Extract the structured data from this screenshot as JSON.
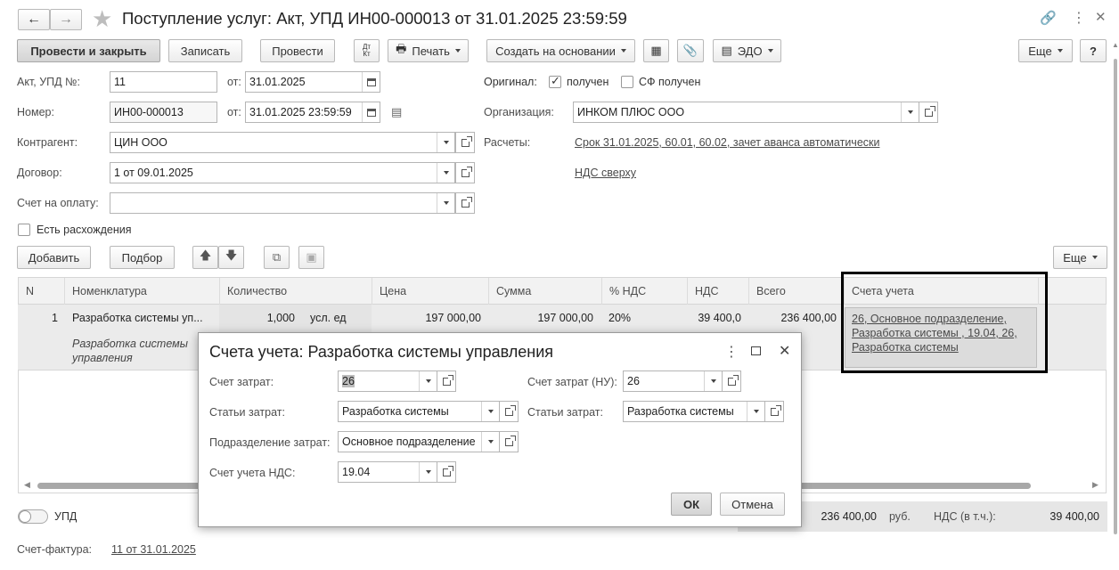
{
  "window": {
    "title": "Поступление услуг: Акт, УПД ИН00-000013 от 31.01.2025 23:59:59"
  },
  "toolbar": {
    "post_close": "Провести и закрыть",
    "save": "Записать",
    "post": "Провести",
    "dt_kt_top": "Дт",
    "dt_kt_bottom": "Кт",
    "print": "Печать",
    "create_based": "Создать на основании",
    "edo": "ЭДО",
    "more": "Еще",
    "help": "?"
  },
  "form": {
    "act_label": "Акт, УПД №:",
    "act_value": "11",
    "from_label": "от:",
    "act_date": "31.01.2025",
    "number_label": "Номер:",
    "number_value": "ИН00-000013",
    "number_date": "31.01.2025 23:59:59",
    "counterparty_label": "Контрагент:",
    "counterparty_value": "ЦИН ООО",
    "contract_label": "Договор:",
    "contract_value": "1 от 09.01.2025",
    "invoice_label": "Счет на оплату:",
    "invoice_value": "",
    "discrepancy_label": "Есть расхождения",
    "original_label": "Оригинал:",
    "received_label": "получен",
    "sf_received_label": "СФ получен",
    "org_label": "Организация:",
    "org_value": "ИНКОМ ПЛЮС ООО",
    "settlements_label": "Расчеты:",
    "settlements_link": "Срок 31.01.2025, 60.01, 60.02, зачет аванса автоматически",
    "vat_link": "НДС сверху"
  },
  "table_toolbar": {
    "add": "Добавить",
    "select": "Подбор",
    "more": "Еще"
  },
  "table": {
    "headers": [
      "N",
      "Номенклатура",
      "Количество",
      "Цена",
      "Сумма",
      "% НДС",
      "НДС",
      "Всего",
      "Счета учета"
    ],
    "row": {
      "n": "1",
      "nomenclature": "Разработка системы уп...",
      "nomenclature_desc_1": "Разработка системы",
      "nomenclature_desc_2": "управления",
      "qty": "1,000",
      "unit": "усл. ед",
      "price": "197 000,00",
      "sum": "197 000,00",
      "vat_rate": "20%",
      "vat": "39 400,0",
      "total": "236 400,00",
      "accounts_1": "26, Основное подразделение,",
      "accounts_2": "Разработка системы , 19.04, 26,",
      "accounts_3": "Разработка системы"
    }
  },
  "footer": {
    "upd_label": "УПД",
    "total": "236 400,00",
    "currency": "руб.",
    "vat_incl_label": "НДС (в т.ч.):",
    "vat_incl_value": "39 400,00",
    "sf_label": "Счет-фактура:",
    "sf_link": "11 от 31.01.2025"
  },
  "dialog": {
    "title": "Счета учета: Разработка системы управления",
    "cost_account_label": "Счет затрат:",
    "cost_account_value": "26",
    "cost_account_nu_label": "Счет затрат (НУ):",
    "cost_account_nu_value": "26",
    "cost_items_label": "Статьи затрат:",
    "cost_items_value": "Разработка системы",
    "cost_items_nu_label": "Статьи затрат:",
    "cost_items_nu_value": "Разработка системы",
    "division_label": "Подразделение затрат:",
    "division_value": "Основное подразделение",
    "vat_account_label": "Счет учета НДС:",
    "vat_account_value": "19.04",
    "ok": "ОК",
    "cancel": "Отмена"
  },
  "colors": {
    "highlight_border": "#000000",
    "row_bg": "#ebebeb",
    "header_bg": "#f2f2f2"
  }
}
